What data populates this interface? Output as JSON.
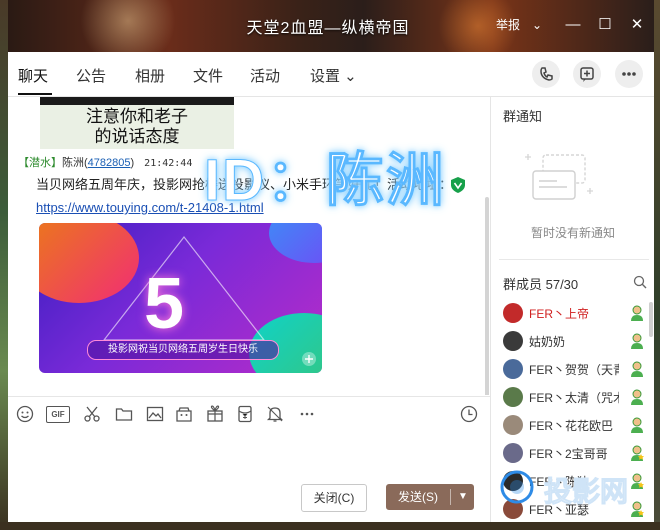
{
  "window": {
    "title": "天堂2血盟—纵横帝国",
    "report_label": "举报",
    "minimize_glyph": "—",
    "maximize_glyph": "☐",
    "close_glyph": "✕",
    "more_glyph": "⌄"
  },
  "tabs": [
    {
      "label": "聊天",
      "active": true
    },
    {
      "label": "公告"
    },
    {
      "label": "相册"
    },
    {
      "label": "文件"
    },
    {
      "label": "活动"
    },
    {
      "label": "设置 ⌄"
    }
  ],
  "chat": {
    "prev_image_text": "注意你和老子\n的说话态度",
    "message": {
      "tag": "【潜水】",
      "sender": "陈洲",
      "uid": "4782805",
      "time": "21:42:44",
      "text": "当贝网络五周年庆，投影网抢楼送投影仪、小米手环等好礼！活动地址：",
      "link": "https://www.touying.com/t-21408-1.html",
      "image": {
        "big_number": "5",
        "banner": "投影网祝当贝网络五周岁生日快乐",
        "overlay_text": "ID：陈洲"
      }
    }
  },
  "composer": {
    "close_label": "关闭(C)",
    "send_label": "发送(S)",
    "toolbar_icons": [
      "emoji-icon",
      "gif-icon",
      "scissors-icon",
      "folder-icon",
      "image-icon",
      "shop-icon",
      "gift-icon",
      "red-packet-icon",
      "bell-icon",
      "ellipsis-icon",
      "history-icon"
    ],
    "gif_text": "GIF"
  },
  "sidebar": {
    "notice_title": "群通知",
    "notice_empty": "暂时没有新通知",
    "members_title": "群成员 57/30",
    "members": [
      {
        "name": "FER丶上帝",
        "owner": true,
        "avatar_color": "#c22a2a",
        "badge": "admin"
      },
      {
        "name": "姑奶奶",
        "owner": false,
        "avatar_color": "#3a3a3a",
        "badge": "admin"
      },
      {
        "name": "FER丶贺贺（天青",
        "owner": false,
        "avatar_color": "#4a6a9a",
        "badge": "admin"
      },
      {
        "name": "FER丶太清（咒术",
        "owner": false,
        "avatar_color": "#5a7a4a",
        "badge": "admin"
      },
      {
        "name": "FER丶花花欧巴",
        "owner": false,
        "avatar_color": "#9a8a7a",
        "badge": "admin"
      },
      {
        "name": "FER丶2宝哥哥",
        "owner": false,
        "avatar_color": "#6a6a8a",
        "badge": "star"
      },
      {
        "name": "FER丶陈独",
        "owner": false,
        "avatar_color": "#2a2a2a",
        "badge": "star"
      },
      {
        "name": "FER丶亚瑟",
        "owner": false,
        "avatar_color": "#8a4a3a",
        "badge": "star"
      }
    ]
  },
  "watermark": {
    "text": "投影网"
  },
  "colors": {
    "send_button": "#8a6a5a",
    "owner_name": "#d02020",
    "link": "#1a4fb4",
    "shield": "#17a04a"
  }
}
